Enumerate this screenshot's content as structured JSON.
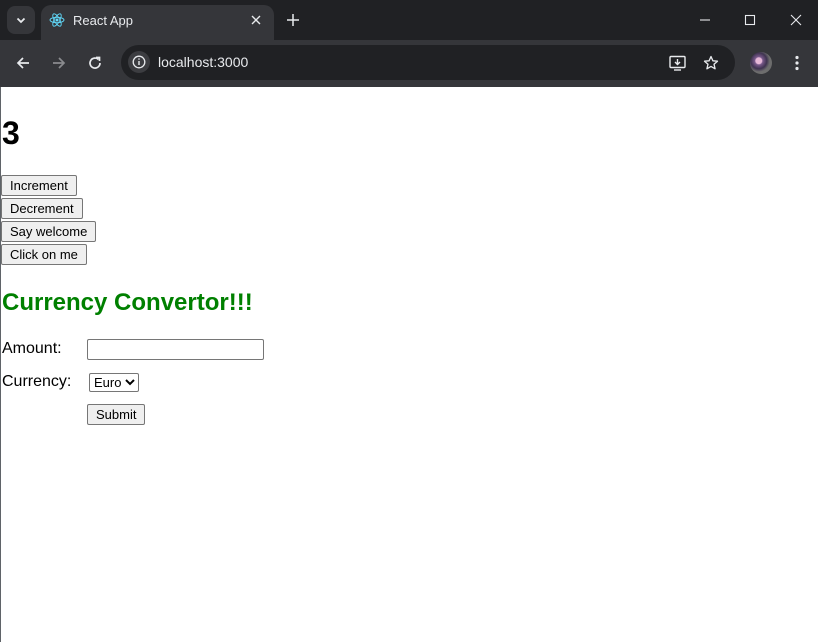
{
  "browser": {
    "tab_title": "React App",
    "url": "localhost:3000",
    "icons": {
      "tab_list": "chevron-down-icon",
      "favicon": "react-icon",
      "tab_close": "close-icon",
      "new_tab": "plus-icon",
      "minimize": "minimize-icon",
      "maximize": "maximize-icon",
      "close_window": "close-icon",
      "back": "arrow-left-icon",
      "forward": "arrow-right-icon",
      "reload": "reload-icon",
      "site_info": "info-icon",
      "install": "install-app-icon",
      "bookmark": "star-icon",
      "profile": "avatar",
      "menu": "kebab-menu-icon"
    }
  },
  "counter": {
    "value": "3",
    "buttons": {
      "increment": "Increment",
      "decrement": "Decrement",
      "welcome": "Say welcome",
      "click": "Click on me"
    }
  },
  "converter": {
    "title": "Currency Convertor!!!",
    "title_color": "#008000",
    "amount_label": "Amount:",
    "amount_value": "",
    "currency_label": "Currency:",
    "currency_selected": "Euro",
    "submit_label": "Submit"
  }
}
